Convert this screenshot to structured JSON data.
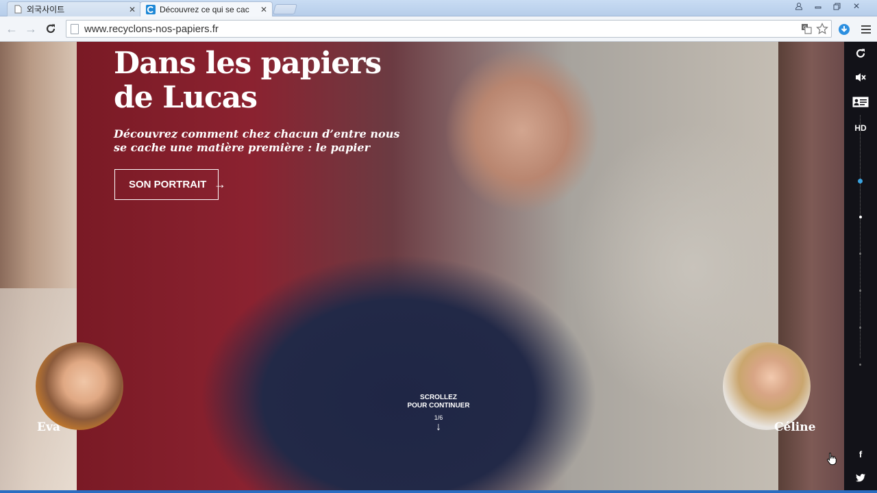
{
  "browser": {
    "tabs": [
      {
        "title": "외국사이트",
        "active": false
      },
      {
        "title": "Découvrez ce qui se cac",
        "active": true
      }
    ],
    "url": "www.recyclons-nos-papiers.fr"
  },
  "hero": {
    "title_line1": "Dans les papiers",
    "title_line2": "de Lucas",
    "subtitle_line1": "Découvrez comment chez chacun d’entre nous",
    "subtitle_line2": "se cache une matière première : le papier",
    "cta_label": "SON PORTRAIT",
    "cta_arrow": "→"
  },
  "profiles": {
    "left_name": "Eva",
    "right_name": "Céline"
  },
  "scroll": {
    "line1": "SCROLLEZ",
    "line2": "POUR CONTINUER",
    "counter": "1/6",
    "arrow": "↓"
  },
  "rail": {
    "hd_label": "HD",
    "icons": [
      "replay-icon",
      "sound-off-icon",
      "id-card-icon",
      "hd-icon",
      "facebook-icon",
      "twitter-icon"
    ],
    "facebook_glyph": "f",
    "active_step": 1,
    "steps": 6
  },
  "colors": {
    "accent_blue": "#3aa3e0",
    "hero_red": "#8b2230",
    "rail_bg": "#121218"
  }
}
